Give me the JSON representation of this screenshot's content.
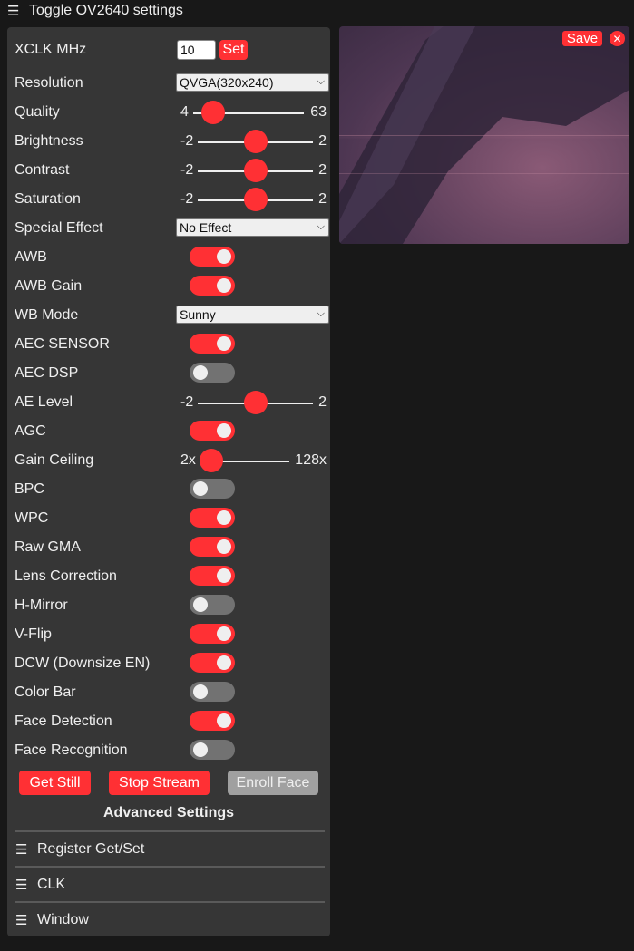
{
  "header": {
    "icon": "hamburger-icon",
    "title": "Toggle OV2640 settings"
  },
  "colors": {
    "accent": "#ff3034",
    "panel": "#363636",
    "background": "#181818",
    "switch_off": "#727272",
    "disabled_button": "#a0a0a0"
  },
  "controls": {
    "xclk": {
      "label": "XCLK MHz",
      "value": "10",
      "button": "Set"
    },
    "resolution": {
      "label": "Resolution",
      "selected": "QVGA(320x240)"
    },
    "quality": {
      "label": "Quality",
      "min": "4",
      "max": "63",
      "value": 10
    },
    "brightness": {
      "label": "Brightness",
      "min": "-2",
      "max": "2",
      "value": 0
    },
    "contrast": {
      "label": "Contrast",
      "min": "-2",
      "max": "2",
      "value": 0
    },
    "saturation": {
      "label": "Saturation",
      "min": "-2",
      "max": "2",
      "value": 0
    },
    "special_effect": {
      "label": "Special Effect",
      "selected": "No Effect"
    },
    "awb": {
      "label": "AWB",
      "on": true
    },
    "awb_gain": {
      "label": "AWB Gain",
      "on": true
    },
    "wb_mode": {
      "label": "WB Mode",
      "selected": "Sunny"
    },
    "aec_sensor": {
      "label": "AEC SENSOR",
      "on": true
    },
    "aec_dsp": {
      "label": "AEC DSP",
      "on": false
    },
    "ae_level": {
      "label": "AE Level",
      "min": "-2",
      "max": "2",
      "value": 0
    },
    "agc": {
      "label": "AGC",
      "on": true
    },
    "gain_ceiling": {
      "label": "Gain Ceiling",
      "min": "2x",
      "max": "128x",
      "value": 0,
      "range": [
        0,
        6
      ]
    },
    "bpc": {
      "label": "BPC",
      "on": false
    },
    "wpc": {
      "label": "WPC",
      "on": true
    },
    "raw_gma": {
      "label": "Raw GMA",
      "on": true
    },
    "lens_correction": {
      "label": "Lens Correction",
      "on": true
    },
    "h_mirror": {
      "label": "H-Mirror",
      "on": false
    },
    "v_flip": {
      "label": "V-Flip",
      "on": true
    },
    "dcw": {
      "label": "DCW (Downsize EN)",
      "on": true
    },
    "color_bar": {
      "label": "Color Bar",
      "on": false
    },
    "face_detection": {
      "label": "Face Detection",
      "on": true
    },
    "face_recognition": {
      "label": "Face Recognition",
      "on": false
    }
  },
  "buttons": {
    "get_still": "Get Still",
    "stop_stream": "Stop Stream",
    "enroll_face": "Enroll Face"
  },
  "advanced": {
    "title": "Advanced Settings",
    "sections": [
      {
        "icon": "hamburger-icon",
        "label": "Register Get/Set"
      },
      {
        "icon": "hamburger-icon",
        "label": "CLK"
      },
      {
        "icon": "hamburger-icon",
        "label": "Window"
      }
    ]
  },
  "stream": {
    "save_label": "Save",
    "close_icon": "close-icon"
  }
}
